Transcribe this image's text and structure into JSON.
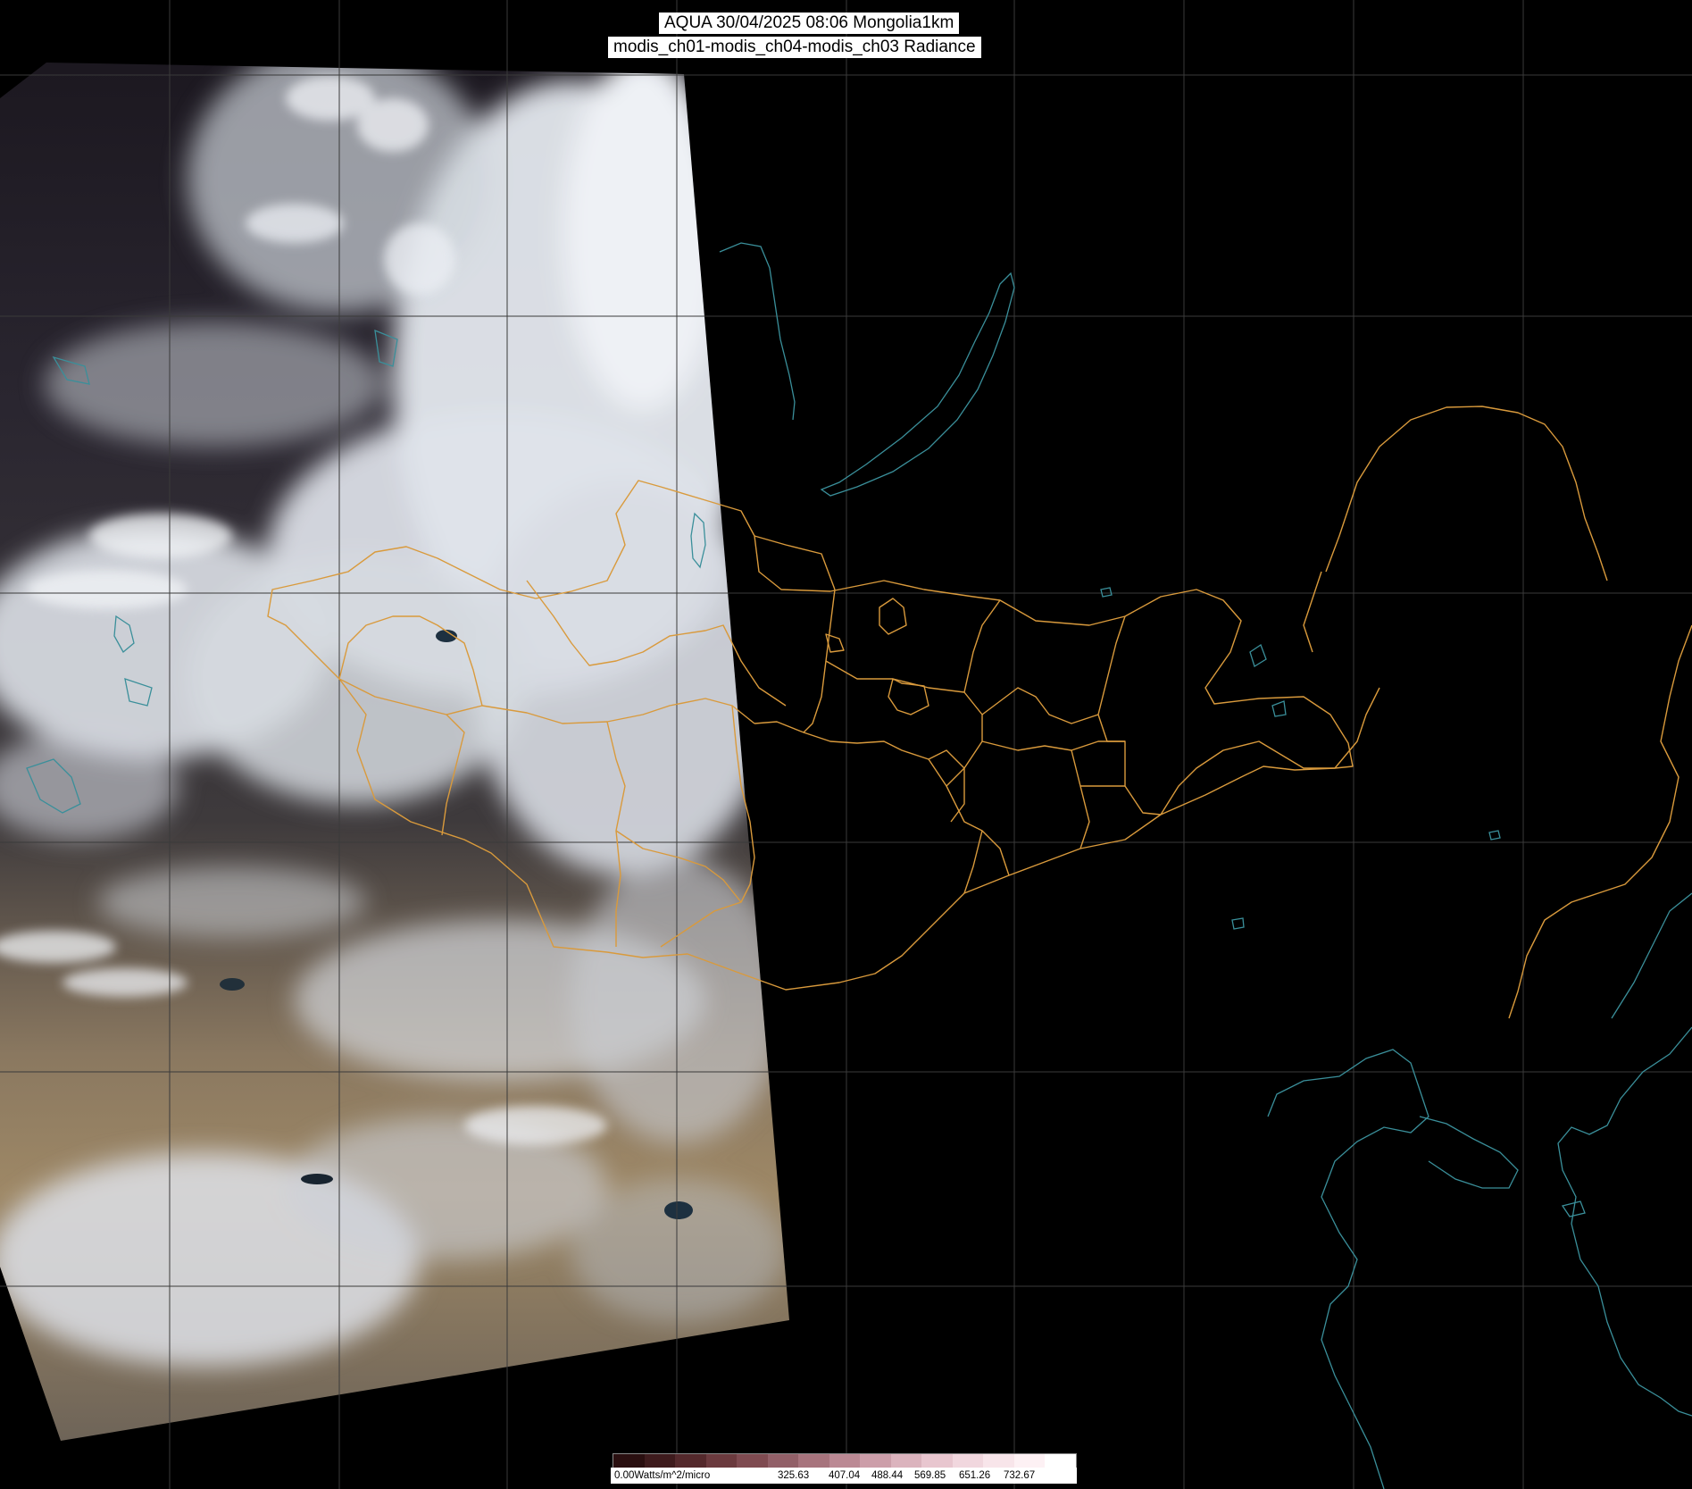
{
  "title": {
    "line1": "AQUA 30/04/2025 08:06 Mongolia1km",
    "line2": "modis_ch01-modis_ch04-modis_ch03 Radiance"
  },
  "legend": {
    "labels": [
      "0.00Watts/m^2/micro",
      "325.63",
      "407.04",
      "488.44",
      "569.85",
      "651.26",
      "732.67"
    ],
    "colors": [
      "#2a0f10",
      "#3e1b1d",
      "#54292c",
      "#6b3a3e",
      "#7f4b51",
      "#926068",
      "#a7747d",
      "#bb8994",
      "#cc9ea9",
      "#dbb3bd",
      "#e8c6cf",
      "#f1d7de",
      "#f8e5ea",
      "#fdf1f4",
      "#ffffff"
    ]
  },
  "colors": {
    "graticule": "#3a3a3a",
    "admin_border": "#d99a3c",
    "coast": "#3a8f9a",
    "cloud": "#e8ecf2",
    "desert": "#a08a68",
    "terrain_dark": "#2e2a30"
  }
}
